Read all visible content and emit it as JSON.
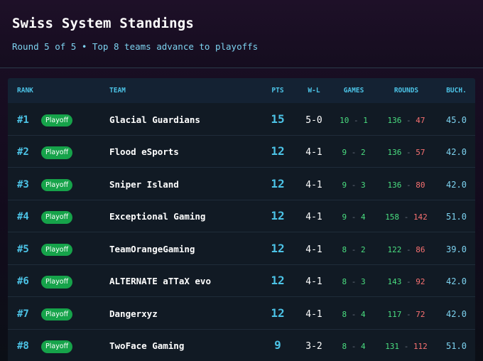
{
  "header": {
    "title": "Swiss System Standings",
    "subtitle": "Round 5 of 5 • Top 8 teams advance to playoffs"
  },
  "columns": {
    "rank": "RANK",
    "team": "TEAM",
    "pts": "PTS",
    "wl": "W-L",
    "games": "GAMES",
    "rounds": "ROUNDS",
    "buch": "BUCH."
  },
  "colors": {
    "accent": "#4cc3e6",
    "badge": "#16a34a",
    "win": "#4ade80",
    "loss": "#f87171"
  },
  "rows": [
    {
      "rank": "#1",
      "badge": "Playoff",
      "team": "Glacial Guardians",
      "pts": "15",
      "wl": "5-0",
      "games_w": "10",
      "games_l": "1",
      "rounds_w": "136",
      "rounds_l": "47",
      "buch": "45.0"
    },
    {
      "rank": "#2",
      "badge": "Playoff",
      "team": "Flood eSports",
      "pts": "12",
      "wl": "4-1",
      "games_w": "9",
      "games_l": "2",
      "rounds_w": "136",
      "rounds_l": "57",
      "buch": "42.0"
    },
    {
      "rank": "#3",
      "badge": "Playoff",
      "team": "Sniper Island",
      "pts": "12",
      "wl": "4-1",
      "games_w": "9",
      "games_l": "3",
      "rounds_w": "136",
      "rounds_l": "80",
      "buch": "42.0"
    },
    {
      "rank": "#4",
      "badge": "Playoff",
      "team": "Exceptional Gaming",
      "pts": "12",
      "wl": "4-1",
      "games_w": "9",
      "games_l": "4",
      "rounds_w": "158",
      "rounds_l": "142",
      "buch": "51.0"
    },
    {
      "rank": "#5",
      "badge": "Playoff",
      "team": "TeamOrangeGaming",
      "pts": "12",
      "wl": "4-1",
      "games_w": "8",
      "games_l": "2",
      "rounds_w": "122",
      "rounds_l": "86",
      "buch": "39.0"
    },
    {
      "rank": "#6",
      "badge": "Playoff",
      "team": "ALTERNATE aTTaX evo",
      "pts": "12",
      "wl": "4-1",
      "games_w": "8",
      "games_l": "3",
      "rounds_w": "143",
      "rounds_l": "92",
      "buch": "42.0"
    },
    {
      "rank": "#7",
      "badge": "Playoff",
      "team": "Dangerxyz",
      "pts": "12",
      "wl": "4-1",
      "games_w": "8",
      "games_l": "4",
      "rounds_w": "117",
      "rounds_l": "72",
      "buch": "42.0"
    },
    {
      "rank": "#8",
      "badge": "Playoff",
      "team": "TwoFace Gaming",
      "pts": "9",
      "wl": "3-2",
      "games_w": "8",
      "games_l": "4",
      "rounds_w": "131",
      "rounds_l": "112",
      "buch": "51.0"
    }
  ]
}
